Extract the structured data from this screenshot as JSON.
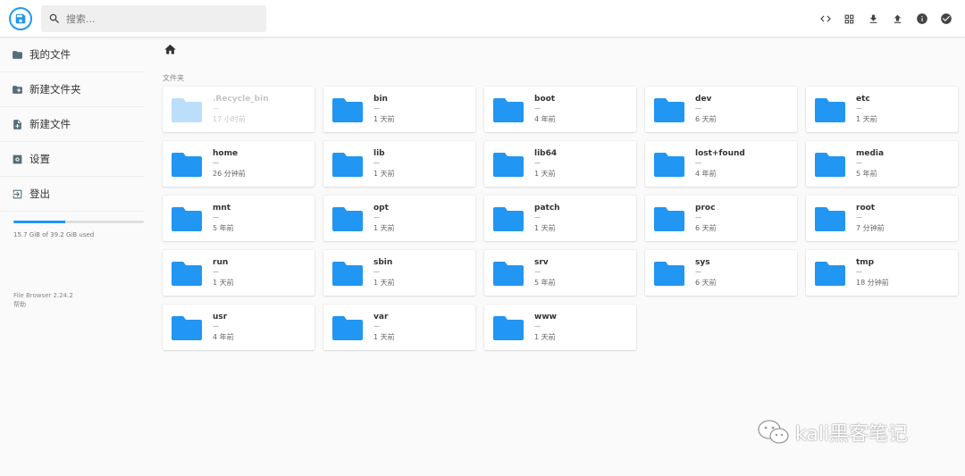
{
  "header": {
    "search_placeholder": "搜索...",
    "actions": [
      {
        "name": "code-view-icon"
      },
      {
        "name": "grid-view-icon"
      },
      {
        "name": "download-icon"
      },
      {
        "name": "upload-icon"
      },
      {
        "name": "info-icon"
      },
      {
        "name": "check-circle-icon"
      }
    ]
  },
  "sidebar": {
    "items": [
      {
        "label": "我的文件",
        "icon": "folder-icon"
      },
      {
        "label": "新建文件夹",
        "icon": "new-folder-icon"
      },
      {
        "label": "新建文件",
        "icon": "new-file-icon"
      },
      {
        "label": "设置",
        "icon": "settings-icon"
      },
      {
        "label": "登出",
        "icon": "logout-icon"
      }
    ],
    "storage_text": "15.7 GiB of 39.2 GiB used",
    "storage_fraction": 0.4,
    "version": "File Browser 2.24.2",
    "help": "帮助"
  },
  "main": {
    "breadcrumb_icon": "home-icon",
    "section_title": "文件夹",
    "folders": [
      {
        "name": ".Recycle_bin",
        "size": "—",
        "time": "17 小时前",
        "faded": true
      },
      {
        "name": "bin",
        "size": "—",
        "time": "1 天前"
      },
      {
        "name": "boot",
        "size": "—",
        "time": "4 年前"
      },
      {
        "name": "dev",
        "size": "—",
        "time": "6 天前"
      },
      {
        "name": "etc",
        "size": "—",
        "time": "1 天前"
      },
      {
        "name": "home",
        "size": "—",
        "time": "26 分钟前"
      },
      {
        "name": "lib",
        "size": "—",
        "time": "1 天前"
      },
      {
        "name": "lib64",
        "size": "—",
        "time": "1 天前"
      },
      {
        "name": "lost+found",
        "size": "—",
        "time": "4 年前"
      },
      {
        "name": "media",
        "size": "—",
        "time": "5 年前"
      },
      {
        "name": "mnt",
        "size": "—",
        "time": "5 年前"
      },
      {
        "name": "opt",
        "size": "—",
        "time": "1 天前"
      },
      {
        "name": "patch",
        "size": "—",
        "time": "1 天前"
      },
      {
        "name": "proc",
        "size": "—",
        "time": "6 天前"
      },
      {
        "name": "root",
        "size": "—",
        "time": "7 分钟前"
      },
      {
        "name": "run",
        "size": "—",
        "time": "1 天前"
      },
      {
        "name": "sbin",
        "size": "—",
        "time": "1 天前"
      },
      {
        "name": "srv",
        "size": "—",
        "time": "5 年前"
      },
      {
        "name": "sys",
        "size": "—",
        "time": "6 天前"
      },
      {
        "name": "tmp",
        "size": "—",
        "time": "18 分钟前"
      },
      {
        "name": "usr",
        "size": "—",
        "time": "4 年前"
      },
      {
        "name": "var",
        "size": "—",
        "time": "1 天前"
      },
      {
        "name": "www",
        "size": "—",
        "time": "1 天前"
      }
    ]
  },
  "watermark": {
    "text": "kali黑客笔记"
  },
  "colors": {
    "accent": "#2196f3",
    "folder": "#2196f3",
    "folder_faded": "#bbdefb",
    "icon_dark": "#546e7a"
  }
}
